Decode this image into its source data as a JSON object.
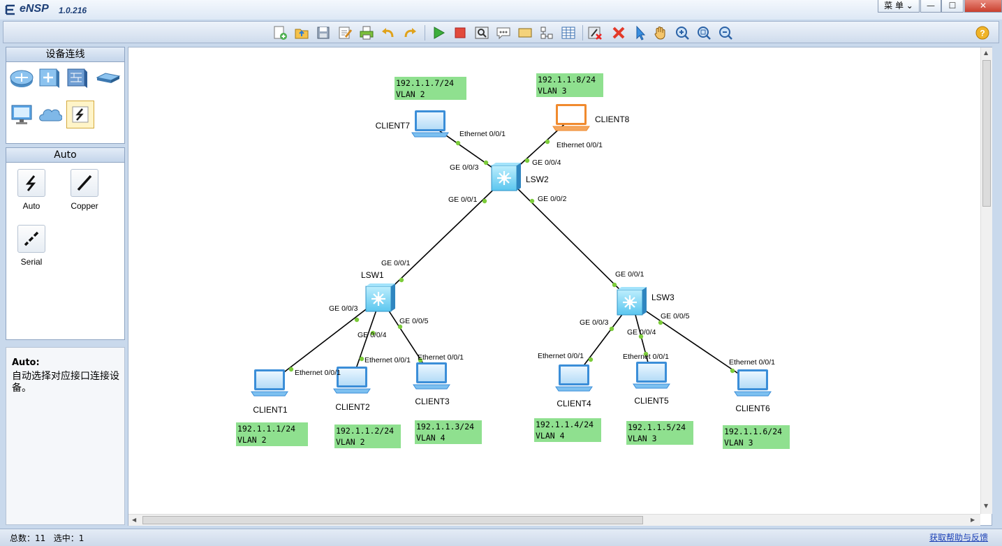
{
  "app": {
    "name": "eNSP",
    "version": "1.0.216"
  },
  "window": {
    "menu_label": "菜 单",
    "min_symbol": "—",
    "max_symbol": "☐",
    "close_symbol": "✕"
  },
  "toolbar": {
    "icons": [
      "new-topology",
      "open-file",
      "save",
      "save-as",
      "print",
      "undo",
      "redo",
      "start-device",
      "stop-device",
      "capture",
      "text-note",
      "rectangle",
      "topology-view",
      "grid",
      "delete-all",
      "delete",
      "select",
      "pan",
      "zoom-in",
      "zoom-fit",
      "zoom-out",
      "help"
    ]
  },
  "device_panel": {
    "title": "设备连线"
  },
  "cable_panel": {
    "title": "Auto",
    "items": [
      {
        "label": "Auto"
      },
      {
        "label": "Copper"
      },
      {
        "label": "Serial"
      }
    ]
  },
  "help": {
    "title": "Auto:",
    "text": "自动选择对应接口连接设备。"
  },
  "topology": {
    "switches": [
      {
        "name": "LSW2"
      },
      {
        "name": "LSW1"
      },
      {
        "name": "LSW3"
      }
    ],
    "clients": [
      {
        "name": "CLIENT7",
        "ip": "192.1.1.7/24",
        "vlan": "VLAN 2"
      },
      {
        "name": "CLIENT8",
        "ip": "192.1.1.8/24",
        "vlan": "VLAN 3"
      },
      {
        "name": "CLIENT1",
        "ip": "192.1.1.1/24",
        "vlan": "VLAN 2"
      },
      {
        "name": "CLIENT2",
        "ip": "192.1.1.2/24",
        "vlan": "VLAN 2"
      },
      {
        "name": "CLIENT3",
        "ip": "192.1.1.3/24",
        "vlan": "VLAN 4"
      },
      {
        "name": "CLIENT4",
        "ip": "192.1.1.4/24",
        "vlan": "VLAN 4"
      },
      {
        "name": "CLIENT5",
        "ip": "192.1.1.5/24",
        "vlan": "VLAN 3"
      },
      {
        "name": "CLIENT6",
        "ip": "192.1.1.6/24",
        "vlan": "VLAN 3"
      }
    ],
    "links": [
      {
        "a": "CLIENT7",
        "a_port": "Ethernet 0/0/1",
        "b": "LSW2",
        "b_port": "GE 0/0/3"
      },
      {
        "a": "CLIENT8",
        "a_port": "Ethernet 0/0/1",
        "b": "LSW2",
        "b_port": "GE 0/0/4"
      },
      {
        "a": "LSW2",
        "a_port": "GE 0/0/1",
        "b": "LSW1",
        "b_port": "GE 0/0/1"
      },
      {
        "a": "LSW2",
        "a_port": "GE 0/0/2",
        "b": "LSW3",
        "b_port": "GE 0/0/1"
      },
      {
        "a": "LSW1",
        "a_port": "GE 0/0/3",
        "b": "CLIENT1",
        "b_port": "Ethernet 0/0/1"
      },
      {
        "a": "LSW1",
        "a_port": "GE 0/0/4",
        "b": "CLIENT2",
        "b_port": "Ethernet 0/0/1"
      },
      {
        "a": "LSW1",
        "a_port": "GE 0/0/5",
        "b": "CLIENT3",
        "b_port": "Ethernet 0/0/1"
      },
      {
        "a": "LSW3",
        "a_port": "GE 0/0/3",
        "b": "CLIENT4",
        "b_port": "Ethernet 0/0/1"
      },
      {
        "a": "LSW3",
        "a_port": "GE 0/0/4",
        "b": "CLIENT5",
        "b_port": "Ethernet 0/0/1"
      },
      {
        "a": "LSW3",
        "a_port": "GE 0/0/5",
        "b": "CLIENT6",
        "b_port": "Ethernet 0/0/1"
      }
    ]
  },
  "statusbar": {
    "total": "总数：11",
    "selected": "选中：1",
    "help_link": "获取帮助与反馈"
  },
  "colors": {
    "info_box": "#8fe08f",
    "link": "#000000",
    "port_dot": "#7ccc3a",
    "switch": "#58c8f0",
    "client_selected": "#f08a2e"
  }
}
